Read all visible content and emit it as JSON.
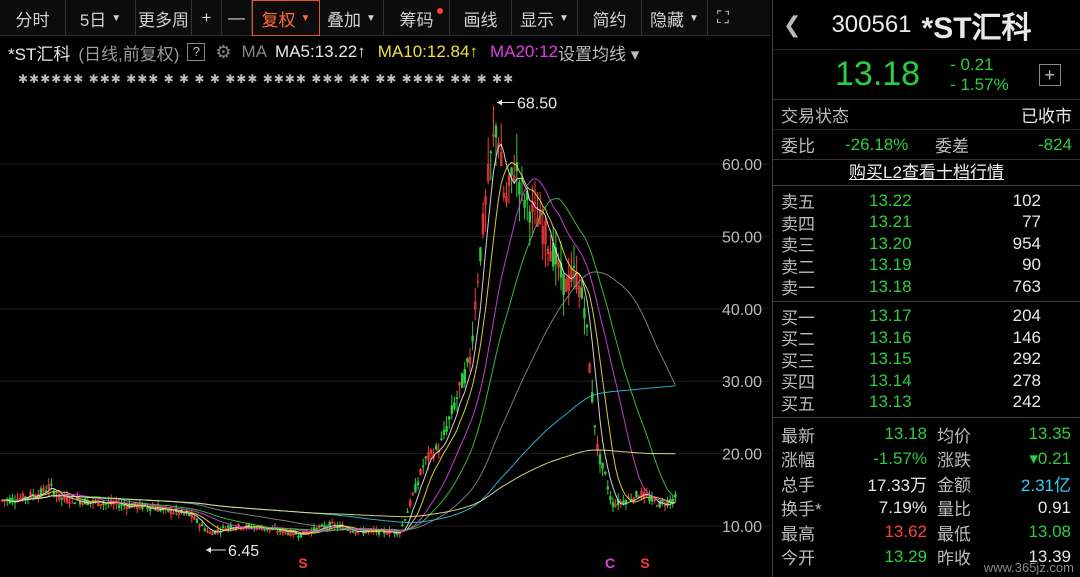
{
  "toolbar": {
    "items": [
      {
        "label": "分时",
        "caret": false
      },
      {
        "label": "5日",
        "caret": true
      },
      {
        "label": "更多周",
        "caret": false
      },
      {
        "label": "+",
        "caret": false
      },
      {
        "label": "—",
        "caret": false
      },
      {
        "label": "复权",
        "caret": true
      },
      {
        "label": "叠加",
        "caret": true
      },
      {
        "label": "筹码",
        "caret": false
      },
      {
        "label": "画线",
        "caret": false
      },
      {
        "label": "显示",
        "caret": true
      },
      {
        "label": "简约",
        "caret": false
      },
      {
        "label": "隐藏",
        "caret": true
      }
    ]
  },
  "chart_header": {
    "name": "*ST汇科",
    "mode": "(日线,前复权)",
    "help": "?",
    "ma_label": "MA",
    "ma5": "MA5:13.22↑",
    "ma10": "MA10:12.84↑",
    "ma20": "MA20:12",
    "set_ma": "设置均线 ▾"
  },
  "info_strip": "✱✱✱✱✱✱ ✱✱✱  ✱✱✱ ✱ ✱   ✱ ✱  ✱✱✱ ✱✱✱✱ ✱✱✱ ✱✱ ✱✱ ✱✱✱✱ ✱✱ ✱ ✱✱",
  "chart_data": {
    "type": "candlestick",
    "ylim": [
      8,
      70
    ],
    "y_ticks": [
      "60.00",
      "50.00",
      "40.00",
      "30.00",
      "20.00",
      "10.00"
    ],
    "annotations": [
      {
        "label": "68.50",
        "kind": "high"
      },
      {
        "label": "6.45",
        "kind": "low"
      }
    ],
    "markers": [
      "S",
      "C",
      "S"
    ],
    "colors": {
      "up": "#ff3b3b",
      "down": "#2ecc40",
      "ma5": "#e8e8e8",
      "ma10": "#f0e040",
      "ma20": "#e040e0",
      "ma30": "#3ecc40",
      "ma60": "#888888",
      "ma120": "#30c0e0",
      "ma250": "#e8e890"
    }
  },
  "quote": {
    "code": "300561",
    "name": "*ST汇科",
    "price": "13.18",
    "change": "- 0.21",
    "change_pct": "- 1.57%"
  },
  "status": {
    "label": "交易状态",
    "value": "已收市"
  },
  "ratio": {
    "label": "委比",
    "value": "-26.18%",
    "diff_label": "委差",
    "diff_value": "-824"
  },
  "l2_link": "购买L2查看十档行情",
  "asks": [
    {
      "label": "卖五",
      "price": "13.22",
      "vol": "102"
    },
    {
      "label": "卖四",
      "price": "13.21",
      "vol": "77"
    },
    {
      "label": "卖三",
      "price": "13.20",
      "vol": "954"
    },
    {
      "label": "卖二",
      "price": "13.19",
      "vol": "90"
    },
    {
      "label": "卖一",
      "price": "13.18",
      "vol": "763"
    }
  ],
  "bids": [
    {
      "label": "买一",
      "price": "13.17",
      "vol": "204"
    },
    {
      "label": "买二",
      "price": "13.16",
      "vol": "146"
    },
    {
      "label": "买三",
      "price": "13.15",
      "vol": "292"
    },
    {
      "label": "买四",
      "price": "13.14",
      "vol": "278"
    },
    {
      "label": "买五",
      "price": "13.13",
      "vol": "242"
    }
  ],
  "stats": [
    {
      "k": "最新",
      "v": "13.18",
      "vc": "green",
      "k2": "均价",
      "v2": "13.35",
      "v2c": "green"
    },
    {
      "k": "涨幅",
      "v": "-1.57%",
      "vc": "green",
      "k2": "涨跌",
      "v2": "▾0.21",
      "v2c": "green"
    },
    {
      "k": "总手",
      "v": "17.33万",
      "vc": "white",
      "k2": "金额",
      "v2": "2.31亿",
      "v2c": "cyan"
    },
    {
      "k": "换手*",
      "v": "7.19%",
      "vc": "white",
      "k2": "量比",
      "v2": "0.91",
      "v2c": "white"
    },
    {
      "k": "最高",
      "v": "13.62",
      "vc": "red",
      "k2": "最低",
      "v2": "13.08",
      "v2c": "green"
    },
    {
      "k": "今开",
      "v": "13.29",
      "vc": "green",
      "k2": "昨收",
      "v2": "13.39",
      "v2c": "white"
    }
  ],
  "watermark": "www.365jz.com"
}
